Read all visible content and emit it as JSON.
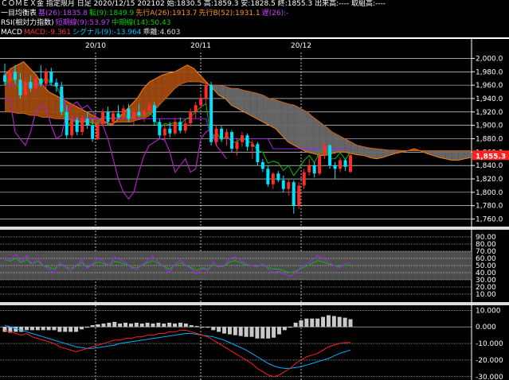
{
  "header": {
    "line1": "ＣＯＭＥＸ金 指定限月 日足 2020/12/15 202102 始:1830.5 高:1859.3 安:1828.5 終:1855.3 出来高:---- 取組高:----",
    "ichimoku": {
      "name": "一目均衡表",
      "base": "基(26):1835.8",
      "conv": "転(9):1849.9",
      "spanA": "先行A(26):1913.7",
      "spanB": "先行B(52):1931.1",
      "lag": "遅(26):-"
    },
    "rsi": {
      "name": "RSI(相対力指数)",
      "short": "短期線(9):53.97",
      "mid": "中期線(14):50.43"
    },
    "macd": {
      "name": "MACD",
      "macd": "MACD:-9.361",
      "signal": "シグナル(9):-13.964",
      "osc": "乖離:4.603"
    }
  },
  "xaxis": [
    "20/10",
    "20/11",
    "20/12"
  ],
  "price_axis": [
    "2,000.0",
    "1,980.0",
    "1,960.0",
    "1,940.0",
    "1,920.0",
    "1,900.0",
    "1,880.0",
    "1,860.0",
    "1,840.0",
    "1,820.0",
    "1,800.0",
    "1,780.0",
    "1,760.0"
  ],
  "current_price": "1,855.3",
  "rsi_axis": [
    "90.00",
    "80.00",
    "70.00",
    "60.00",
    "50.00",
    "40.00",
    "30.00",
    "20.00",
    "10.00"
  ],
  "macd_axis": [
    "10.000",
    "0.000",
    "-10.000",
    "-20.000",
    "-30.000"
  ],
  "colors": {
    "up": "#ff2a2a",
    "down": "#00e0ff",
    "base_line": "#a020f0",
    "conv_line": "#00c000",
    "cloud_a": "#ff8000",
    "cloud_b": "#8a8a8a",
    "lag_line": "#b020c0",
    "rsi_short": "#b020ff",
    "rsi_mid": "#00c000",
    "macd_line": "#ff2020",
    "signal_line": "#00b0ff",
    "histogram": "#c8c8c8"
  },
  "chart_data": [
    {
      "type": "candlestick",
      "title": "ＣＯＭＥＸ金 指定限月 日足",
      "ylim": [
        1750,
        2010
      ],
      "last": {
        "open": 1830.5,
        "high": 1859.3,
        "low": 1828.5,
        "close": 1855.3
      },
      "candles": [
        [
          1975,
          1992,
          1960,
          1965
        ],
        [
          1965,
          1985,
          1955,
          1980
        ],
        [
          1980,
          1990,
          1962,
          1968
        ],
        [
          1968,
          1978,
          1940,
          1945
        ],
        [
          1945,
          1970,
          1940,
          1965
        ],
        [
          1965,
          1975,
          1950,
          1955
        ],
        [
          1955,
          1972,
          1950,
          1970
        ],
        [
          1970,
          1990,
          1958,
          1962
        ],
        [
          1962,
          1985,
          1955,
          1980
        ],
        [
          1980,
          1986,
          1960,
          1964
        ],
        [
          1964,
          1970,
          1950,
          1958
        ],
        [
          1958,
          1965,
          1915,
          1920
        ],
        [
          1920,
          1930,
          1880,
          1885
        ],
        [
          1885,
          1915,
          1880,
          1908
        ],
        [
          1908,
          1912,
          1885,
          1890
        ],
        [
          1890,
          1915,
          1885,
          1910
        ],
        [
          1910,
          1920,
          1895,
          1900
        ],
        [
          1900,
          1910,
          1875,
          1880
        ],
        [
          1880,
          1905,
          1878,
          1902
        ],
        [
          1902,
          1925,
          1898,
          1920
        ],
        [
          1920,
          1928,
          1900,
          1905
        ],
        [
          1905,
          1922,
          1900,
          1918
        ],
        [
          1918,
          1930,
          1910,
          1912
        ],
        [
          1912,
          1930,
          1908,
          1925
        ],
        [
          1925,
          1932,
          1905,
          1910
        ],
        [
          1910,
          1925,
          1900,
          1920
        ],
        [
          1920,
          1932,
          1912,
          1915
        ],
        [
          1915,
          1925,
          1905,
          1922
        ],
        [
          1922,
          1935,
          1915,
          1930
        ],
        [
          1930,
          1935,
          1900,
          1905
        ],
        [
          1905,
          1910,
          1880,
          1885
        ],
        [
          1885,
          1900,
          1878,
          1895
        ],
        [
          1895,
          1905,
          1882,
          1888
        ],
        [
          1888,
          1910,
          1885,
          1905
        ],
        [
          1905,
          1912,
          1888,
          1892
        ],
        [
          1892,
          1908,
          1888,
          1903
        ],
        [
          1903,
          1925,
          1898,
          1920
        ],
        [
          1920,
          1935,
          1910,
          1930
        ],
        [
          1930,
          1948,
          1925,
          1940
        ],
        [
          1940,
          1965,
          1930,
          1960
        ],
        [
          1960,
          1965,
          1870,
          1875
        ],
        [
          1875,
          1900,
          1870,
          1895
        ],
        [
          1895,
          1900,
          1875,
          1880
        ],
        [
          1880,
          1895,
          1870,
          1890
        ],
        [
          1890,
          1893,
          1860,
          1865
        ],
        [
          1865,
          1880,
          1855,
          1875
        ],
        [
          1875,
          1890,
          1868,
          1885
        ],
        [
          1885,
          1888,
          1862,
          1868
        ],
        [
          1868,
          1878,
          1850,
          1872
        ],
        [
          1872,
          1875,
          1840,
          1845
        ],
        [
          1845,
          1850,
          1830,
          1835
        ],
        [
          1835,
          1840,
          1808,
          1812
        ],
        [
          1812,
          1830,
          1805,
          1828
        ],
        [
          1828,
          1832,
          1815,
          1818
        ],
        [
          1818,
          1825,
          1800,
          1805
        ],
        [
          1805,
          1820,
          1795,
          1815
        ],
        [
          1815,
          1818,
          1768,
          1780
        ],
        [
          1780,
          1815,
          1775,
          1810
        ],
        [
          1810,
          1835,
          1805,
          1830
        ],
        [
          1830,
          1850,
          1825,
          1840
        ],
        [
          1840,
          1845,
          1822,
          1828
        ],
        [
          1828,
          1860,
          1825,
          1855
        ],
        [
          1855,
          1875,
          1850,
          1870
        ],
        [
          1870,
          1872,
          1835,
          1840
        ],
        [
          1840,
          1845,
          1820,
          1835
        ],
        [
          1835,
          1852,
          1830,
          1848
        ],
        [
          1848,
          1850,
          1832,
          1838
        ],
        [
          1830.5,
          1859.3,
          1828.5,
          1855.3
        ]
      ],
      "series_note": "ichimoku lines shown as overlays"
    },
    {
      "type": "line",
      "title": "RSI(相対力指数)",
      "ylim": [
        0,
        100
      ],
      "series": [
        {
          "name": "短期線(9)",
          "values": [
            62,
            58,
            66,
            55,
            64,
            52,
            60,
            50,
            45,
            40,
            55,
            48,
            42,
            50,
            58,
            46,
            52,
            60,
            56,
            50,
            62,
            58,
            54,
            47,
            44,
            51,
            57,
            63,
            55,
            48,
            40,
            52,
            58,
            50,
            45,
            38,
            46,
            42,
            55,
            48,
            50,
            60,
            62,
            57,
            52,
            50,
            48,
            53,
            45,
            40,
            42,
            38,
            35,
            40,
            48,
            52,
            58,
            64,
            60,
            54,
            50,
            47,
            52,
            53.97
          ]
        },
        {
          "name": "中期線(14)",
          "values": [
            58,
            56,
            60,
            54,
            58,
            52,
            56,
            50,
            48,
            45,
            52,
            48,
            46,
            49,
            54,
            48,
            51,
            55,
            53,
            50,
            56,
            54,
            52,
            48,
            47,
            50,
            54,
            57,
            53,
            49,
            45,
            50,
            54,
            50,
            47,
            43,
            47,
            45,
            51,
            48,
            49,
            55,
            57,
            54,
            51,
            50,
            49,
            51,
            47,
            45,
            45,
            42,
            40,
            42,
            46,
            49,
            53,
            57,
            55,
            52,
            50,
            49,
            50,
            50.43
          ]
        }
      ]
    },
    {
      "type": "bar",
      "title": "MACD",
      "ylim": [
        -32,
        13
      ],
      "series": [
        {
          "name": "MACD",
          "values": [
            -2,
            -3,
            -4,
            -5,
            -4,
            -6,
            -7,
            -8,
            -9,
            -10,
            -12,
            -13,
            -14,
            -15,
            -14,
            -13,
            -12,
            -11,
            -10,
            -9,
            -8,
            -8,
            -7,
            -7,
            -6,
            -6,
            -5,
            -5,
            -4,
            -4,
            -3,
            -3,
            -2,
            -2,
            -3,
            -4,
            -5,
            -6,
            -8,
            -10,
            -12,
            -14,
            -16,
            -18,
            -20,
            -22,
            -25,
            -27,
            -29,
            -30,
            -29,
            -27,
            -25,
            -22,
            -20,
            -18,
            -17,
            -16,
            -14,
            -12,
            -11,
            -10,
            -9.5,
            -9.361
          ]
        },
        {
          "name": "シグナル(9)",
          "values": [
            1,
            0,
            -1,
            -2,
            -3,
            -4,
            -5,
            -6,
            -7,
            -8,
            -9,
            -10,
            -11,
            -12,
            -12.5,
            -13,
            -13,
            -12.5,
            -12,
            -11.5,
            -11,
            -10,
            -9.5,
            -9,
            -8.5,
            -8,
            -7.5,
            -7,
            -6.5,
            -6,
            -5.5,
            -5,
            -4.5,
            -4,
            -4,
            -4.5,
            -5,
            -5.5,
            -6,
            -7,
            -8,
            -9.5,
            -11,
            -12.5,
            -14,
            -16,
            -18,
            -20,
            -22,
            -23.5,
            -24.5,
            -25,
            -25,
            -24.5,
            -24,
            -23,
            -22,
            -21,
            -20,
            -19,
            -17.5,
            -16,
            -15,
            -13.964
          ]
        },
        {
          "name": "乖離",
          "values": [
            -3,
            -3.5,
            -3,
            -3,
            -2,
            -2,
            -2,
            -2,
            -2,
            -2,
            -3,
            -3,
            -3,
            -3,
            -1.5,
            0,
            1,
            1.5,
            2,
            2.5,
            3,
            2,
            2.5,
            2,
            2.5,
            2,
            2.5,
            2,
            2.5,
            2,
            2.5,
            2,
            2.5,
            2,
            1,
            0.5,
            0,
            -0.5,
            -2,
            -3,
            -4,
            -4.5,
            -5,
            -5.5,
            -6,
            -6,
            -7,
            -7,
            -7,
            -6.5,
            -4.5,
            -2,
            0,
            2.5,
            4,
            5,
            5,
            5,
            6,
            7,
            6.5,
            6,
            5.5,
            4.603
          ]
        }
      ]
    }
  ]
}
